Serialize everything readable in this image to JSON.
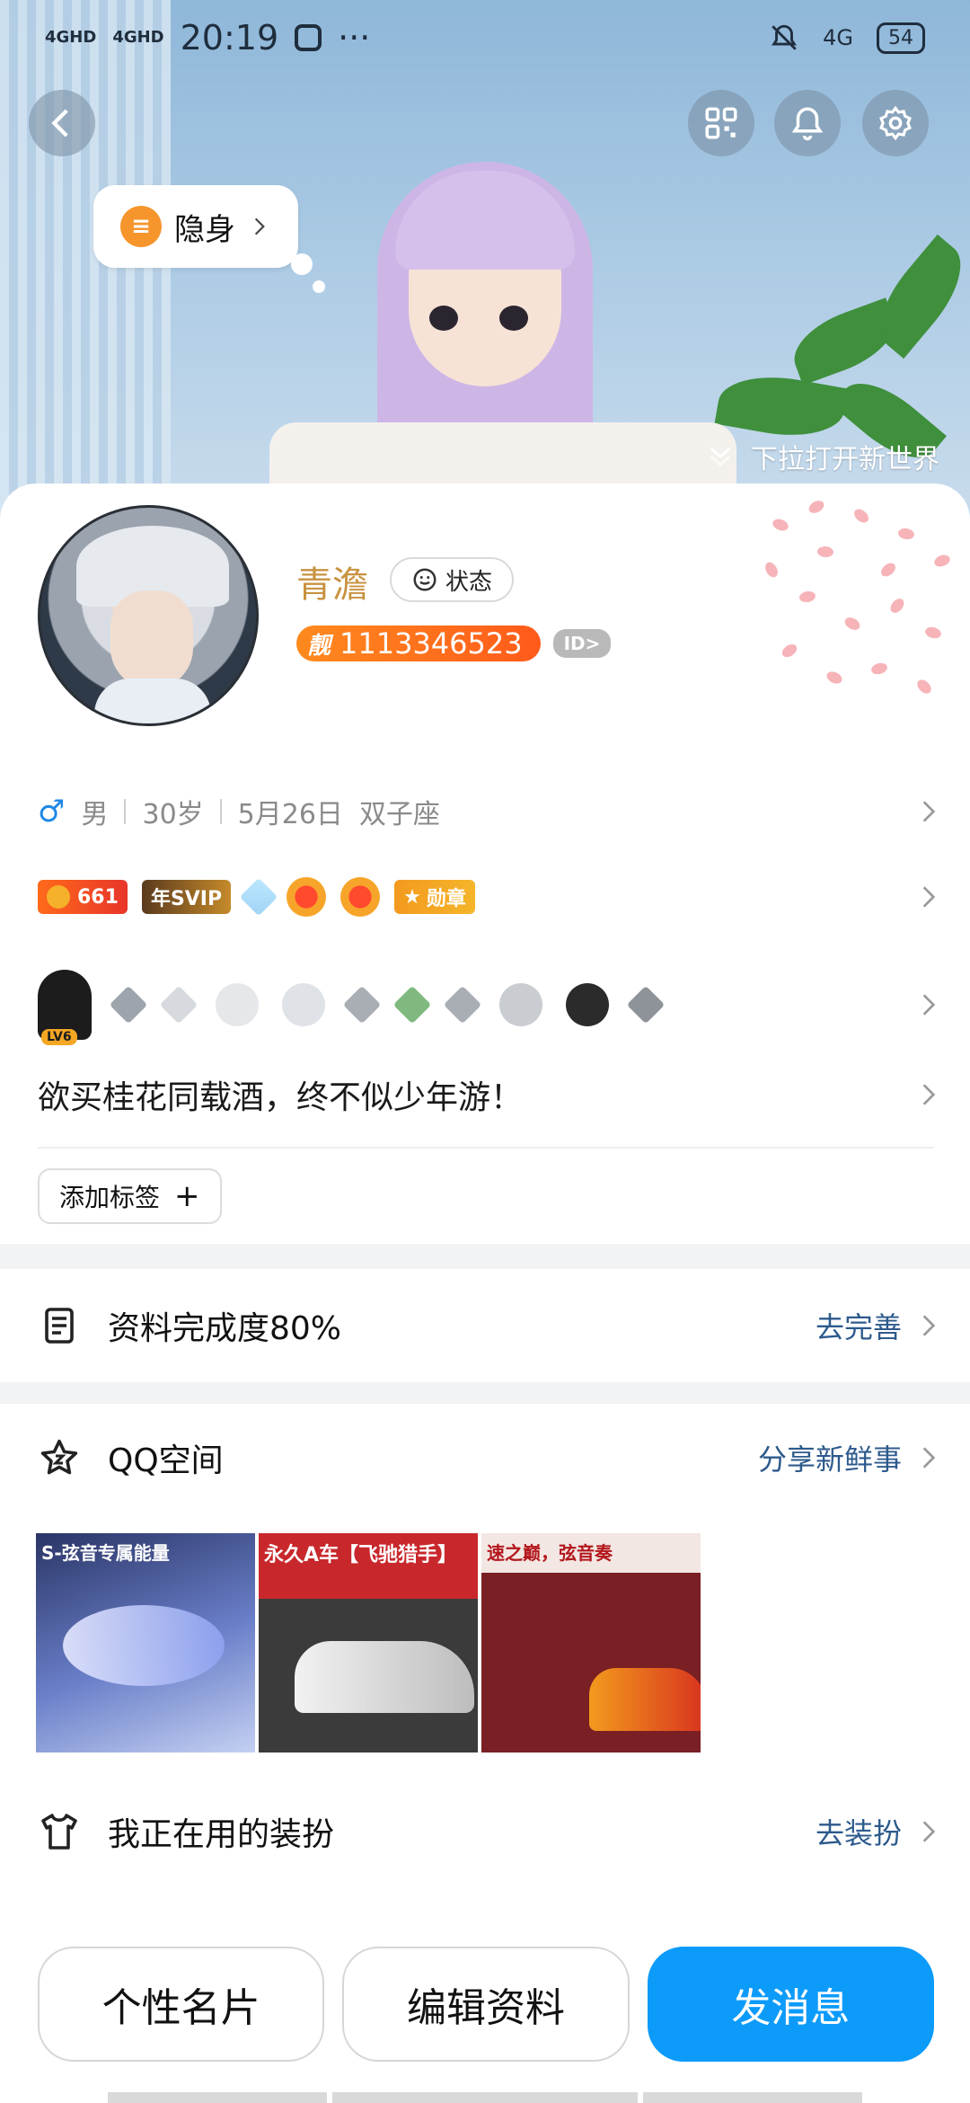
{
  "status_bar": {
    "signal1": "4GHD",
    "signal2": "4GHD",
    "time": "20:19",
    "more": "···",
    "network": "4G",
    "battery": "54"
  },
  "hero": {
    "invisible_label": "隐身",
    "pulldown_text": "下拉打开新世界"
  },
  "profile": {
    "nickname": "青澹",
    "state_label": "状态",
    "liang_tag": "靓",
    "qq_number": "1113346523",
    "id_chip": "ID>",
    "gender_symbol": "♂",
    "gender": "男",
    "age": "30岁",
    "birthday": "5月26日",
    "zodiac": "双子座",
    "coin_count": "661",
    "svip_label": "年SVIP",
    "medal_label": "勋章",
    "level": "LV6",
    "signature": "欲买桂花同载酒，终不似少年游！",
    "add_tag": "添加标签",
    "add_tag_plus": "+"
  },
  "sections": {
    "completion_label": "资料完成度80%",
    "completion_action": "去完善",
    "qzone_label": "QQ空间",
    "qzone_action": "分享新鲜事",
    "outfit_label": "我正在用的装扮",
    "outfit_action": "去装扮"
  },
  "thumbnails": [
    {
      "caption": "S-弦音专属能量",
      "bg": "#2a3566"
    },
    {
      "caption": "永久A车【飞驰猎手】",
      "bg": "#c8282c"
    },
    {
      "caption": "速之巅，弦音奏",
      "bg": "#7a1f24"
    }
  ],
  "buttons": {
    "card": "个性名片",
    "edit": "编辑资料",
    "message": "发消息"
  },
  "colors": {
    "accent": "#0d9bfa",
    "nickname": "#c8923f",
    "liang": "#ff6a1a",
    "link": "#2d5a8c"
  }
}
